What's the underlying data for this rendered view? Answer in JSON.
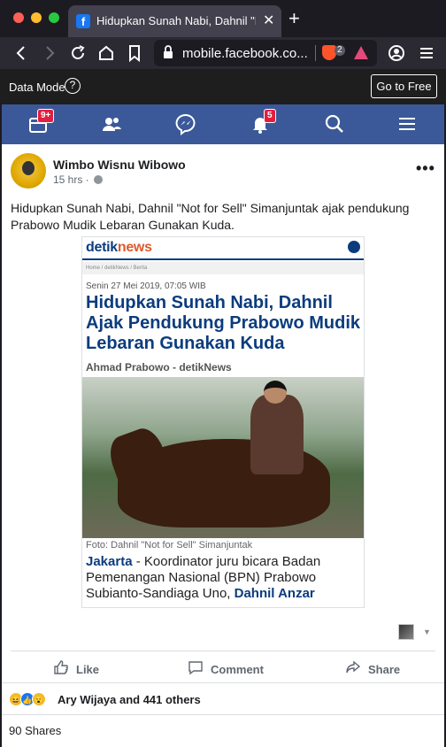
{
  "browser": {
    "tab_title": "Hidupkan Sunah Nabi, Dahnil \"N",
    "tab_favicon": "f",
    "url": "mobile.facebook.co...",
    "brave_count": "2",
    "colors": {
      "titlebar": "#1c1b22",
      "toolbar": "#2b2a33",
      "tab": "#42414d"
    }
  },
  "datamode": {
    "label": "Data Mode",
    "help": "?",
    "button": "Go to Free"
  },
  "fbnav": {
    "feed_badge": "9+",
    "notif_badge": "5",
    "color": "#3b5998"
  },
  "post": {
    "author": "Wimbo Wisnu Wibowo",
    "time": "15 hrs · ",
    "more": "•••",
    "caption": "Hidupkan Sunah Nabi, Dahnil \"Not for Sell\" Simanjuntak ajak pendukung Prabowo Mudik Lebaran Gunakan Kuda.",
    "article": {
      "logo_a": "detik",
      "logo_b": "news",
      "crumb": "Home / detikNews / Berita",
      "date": "Senin 27 Mei 2019, 07:05 WIB",
      "title": "Hidupkan Sunah Nabi, Dahnil Ajak Pendukung Prabowo Mudik Lebaran Gunakan Kuda",
      "author": "Ahmad Prabowo - detikNews",
      "photo_caption": "Foto: Dahnil \"Not for Sell\" Simanjuntak",
      "body_lead": "Jakarta",
      "body": " - Koordinator juru bicara Badan Pemenangan Nasional (BPN) Prabowo Subianto-Sandiaga Uno, ",
      "body_end": "Dahnil Anzar"
    },
    "actions": {
      "like": "Like",
      "comment": "Comment",
      "share": "Share"
    },
    "reactions": "Ary Wijaya and 441 others",
    "shares": "90 Shares"
  }
}
